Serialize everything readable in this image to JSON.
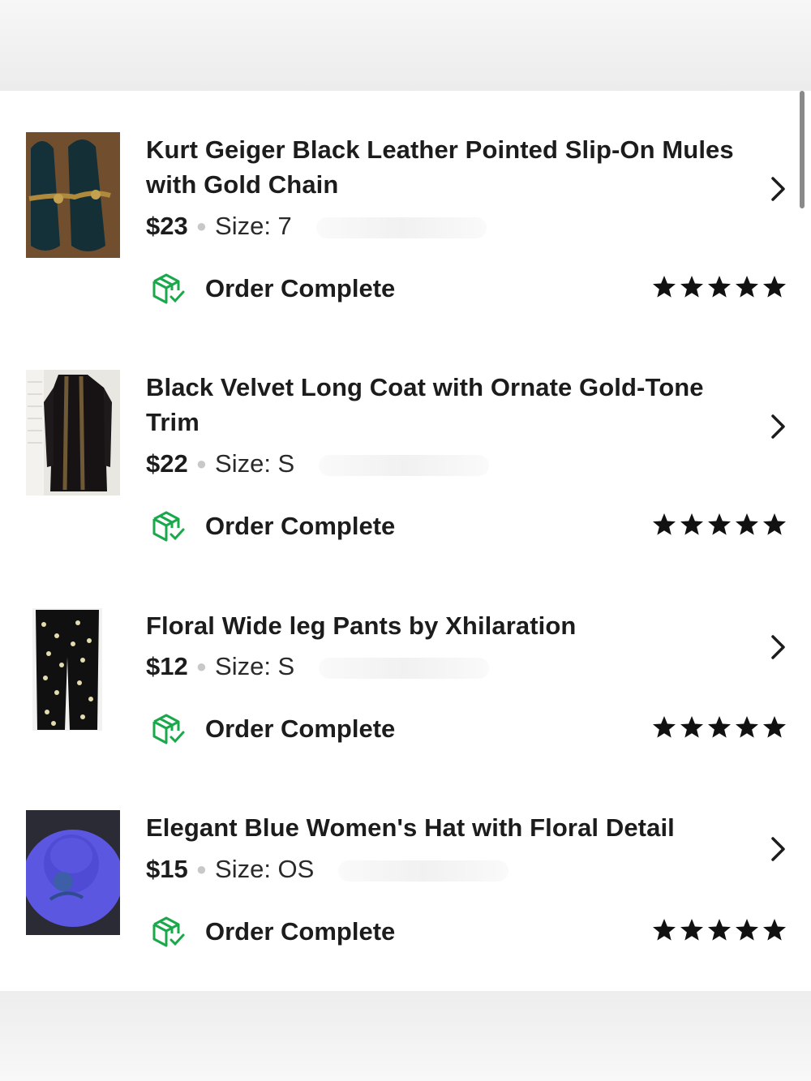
{
  "orders": [
    {
      "title": "Kurt Geiger Black Leather Pointed Slip-On Mules with Gold Chain",
      "price": "$23",
      "size": "Size: 7",
      "status": "Order Complete",
      "rating": 5,
      "image": "black-studded-mules-photo"
    },
    {
      "title": "Black Velvet Long Coat with Ornate Gold-Tone Trim",
      "price": "$22",
      "size": "Size: S",
      "status": "Order Complete",
      "rating": 5,
      "image": "black-velvet-coat-photo"
    },
    {
      "title": "Floral Wide leg Pants by Xhilaration",
      "price": "$12",
      "size": "Size: S",
      "status": "Order Complete",
      "rating": 5,
      "image": "floral-pants-photo"
    },
    {
      "title": "Elegant Blue Women's Hat with Floral Detail",
      "price": "$15",
      "size": "Size: OS",
      "status": "Order Complete",
      "rating": 5,
      "image": "blue-hat-photo"
    }
  ],
  "colors": {
    "status_icon": "#19a84a",
    "stars": "#111111",
    "text": "#1c1c1c"
  }
}
